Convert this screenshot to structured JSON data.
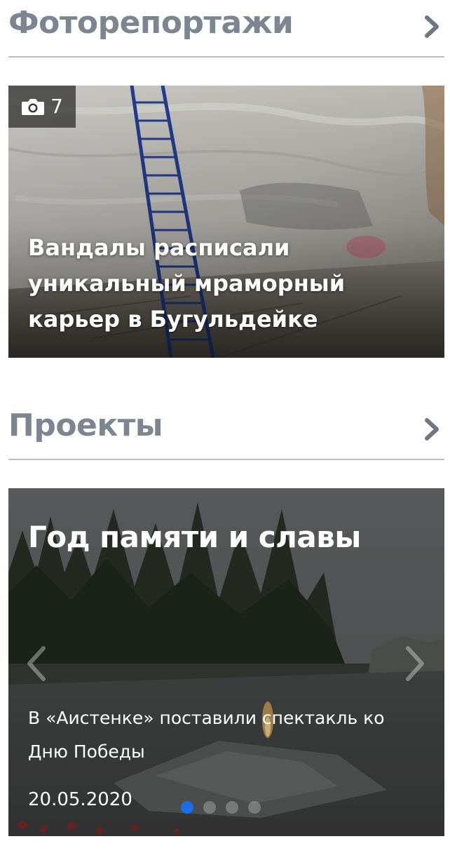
{
  "photo_section": {
    "title": "Фоторепортажи",
    "report": {
      "photo_count": "7",
      "title": "Вандалы расписали уникальный мраморный карьер в Бугульдейке"
    }
  },
  "projects_section": {
    "title": "Проекты",
    "project": {
      "title": "Год памяти и славы",
      "slide_text": "В «Аистенке» поставили спектакль ко Дню Победы",
      "slide_date": "20.05.2020",
      "active_slide": 1
    }
  },
  "icons": [
    "chevron-right-icon",
    "camera-icon",
    "arrow-left-icon",
    "arrow-right-icon"
  ],
  "colors": {
    "heading": "#7d8591",
    "divider": "#b9bdc4",
    "active_dot": "#1a6fe6"
  }
}
